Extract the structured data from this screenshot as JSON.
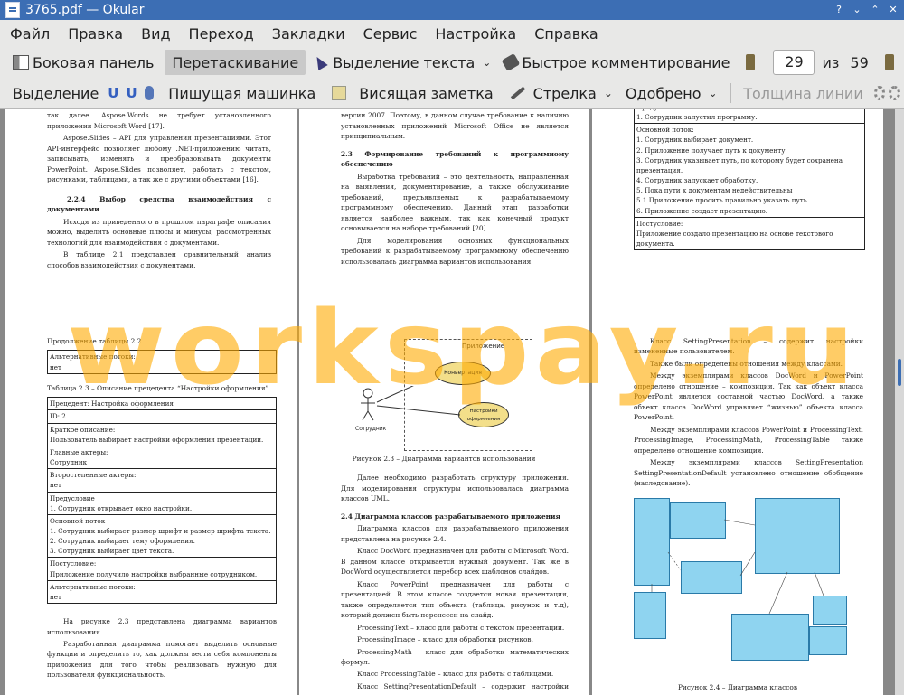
{
  "window": {
    "title": "3765.pdf  — Okular",
    "btn_help": "?",
    "btn_min": "⌄",
    "btn_max": "⌃",
    "btn_close": "✕"
  },
  "menu": [
    "Файл",
    "Правка",
    "Вид",
    "Переход",
    "Закладки",
    "Сервис",
    "Настройка",
    "Справка"
  ],
  "toolbar1": {
    "sidebar": "Боковая панель",
    "drag": "Перетаскивание",
    "text_select": "Выделение текста",
    "quick_comment": "Быстрое комментирование",
    "page_current": "29",
    "page_of": "из",
    "page_total": "59"
  },
  "toolbar2": {
    "highlight": "Выделение",
    "typewriter": "Пишущая машинка",
    "sticky": "Висящая заметка",
    "arrow": "Стрелка",
    "approved": "Одобрено",
    "line_width": "Толщина линии"
  },
  "watermark": "workspay.ru",
  "pages": {
    "p23": {
      "para1": "все типичные задачи: обработка текстов, создание таблиц и так далее. Aspose.Words не требует установленного приложения Microsoft Word [17].",
      "para2": "Aspose.Slides – API для управления презентациями. Этот API-интерфейс позволяет любому .NET-приложению читать, записывать, изменять и преобразовывать документы PowerPoint. Aspose.Slides позволяет, работать с текстом, рисунками, таблицами, а так же с другими объектами [16].",
      "heading": "2.2.4 Выбор средства взаимодействия с документами",
      "para3": "Исходя из приведенного в прошлом параграфе описания можно, выделить основные плюсы и минусы, рассмотренных технологий для взаимодействия с документами.",
      "para4": "В таблице 2.1 представлен сравнительный анализ способов взаимодействия с документами.",
      "num": "23"
    },
    "p24": {
      "para1": "Microsoft Word версии 2007, а также Microsoft PowerPoint версии 2007. Поэтому, в данном случае требование к наличию установленных приложений Microsoft Office не является принципиальным.",
      "heading": "2.3 Формирование требований к программному обеспечению",
      "para2": "Выработка требований – это деятельность, направленная на выявления, документирование, а также обслуживание требований, предъявляемых к разрабатываемому программному обеспечению. Данный этап разработки является наиболее важным, так как конечный продукт основывается на наборе требований [20].",
      "para3": "Для моделирования основных функциональных требований к разрабатываемому программному обеспечению использовалась диаграмма вариантов использования.",
      "num": "24"
    },
    "p25": {
      "rows": [
        "Предусловие\n1. Сотрудник запустил программу.",
        "Основной поток:\n1.  Сотрудник выбирает документ.\n2.  Приложение получает путь к документу.\n3.  Сотрудник указывает путь, по которому будет сохранена презентация.\n4.  Сотрудник запускает обработку.\n5.  Пока пути к документам недействительны\n     5.1 Приложение просить правильно указать путь\n6.  Приложение создает презентацию.",
        "Постусловие:\nПриложение создало презентацию на основе текстового документа."
      ],
      "num": "25"
    },
    "p26": {
      "cont": "Продолжение таблицы 2.2",
      "alt_label": "Альтернативные потоки:",
      "alt_value": "нет",
      "table_title": "Таблица 2.3 – Описание прецедента “Настройки оформления”",
      "rows": [
        "Прецедент: Настройка оформления",
        "ID: 2",
        "Краткое описание:\nПользователь выбирает настройки оформления презентации.",
        "Главные актеры:\nСотрудник",
        "Второстепенные актеры:\nнет",
        "Предусловие\n1. Сотрудник открывает окно настройки.",
        "Основной поток\n1.  Сотрудник выбирает размер шрифт и размер шрифта текста.\n2.  Сотрудник выбирает тему оформления.\n3.  Сотрудник выбирает цвет текста.",
        "Постусловие:\nПриложение получило настройки выбранные сотрудником.",
        "Альтернативные потоки:\nнет"
      ],
      "para1": "На рисунке 2.3 представлена диаграмма вариантов использования.",
      "para2": "Разработанная диаграмма помогает выделить основные функции и определить то, как должны вести себя компоненты приложения для того чтобы реализовать нужную для пользователя функциональность."
    },
    "p27": {
      "uml_app": "Приложение",
      "uml_conv": "Конвертация",
      "uml_settings": "Настройки оформления",
      "uml_actor": "Сотрудник",
      "caption": "Рисунок 2.3 – Диаграмма вариантов использования",
      "para1": "Далее необходимо разработать структуру приложения. Для моделирования структуры использовалась диаграмма классов UML.",
      "heading": "2.4 Диаграмма классов разрабатываемого приложения",
      "para2": "Диаграмма классов для разрабатываемого приложения представлена на рисунке 2.4.",
      "para3": "Класс DocWord предназначен для работы с Microsoft Word. В данном классе открывается нужный документ. Так же в DocWord осуществляется перебор всех шаблонов слайдов.",
      "para4": "Класс PowerPoint предназначен для работы с презентацией. В этом классе создается новая презентация, также определяется тип объекта (таблица, рисунок и т.д), который должен быть перенесен на слайд.",
      "items": [
        "ProcessingText – класс для работы с текстом презентации.",
        "ProcessingImage – класс для обработки рисунков.",
        "ProcessingMath – класс для обработки математических формул.",
        "Класс ProcessingTable – класс для работы с таблицами.",
        "Класс SettingPresentationDefault – содержит настройки презентации по-умолчанию."
      ]
    },
    "p28": {
      "para1": "Класс SettingPresentation – содержит настройки измененные пользователем.",
      "para2": "Также были определены отношения между классами.",
      "para3": "Между экземплярами классов DocWord и PowerPoint определено отношение – композиция. Так как объект класса PowerPoint является составной частью DocWord, а также объект класса DocWord управляет “жизнью” объекта класса PowerPoint.",
      "para4": "Между экземплярами классов PowerPoint и ProcessingText, ProcessingImage, ProcessingMath, ProcessingTable также определено отношение композиция.",
      "para5": "Между экземплярами классов SettingPresentation SettingPresentationDefault установлено отношение обобщение (наследование).",
      "caption": "Рисунок 2.4 – Диаграмма классов"
    }
  }
}
